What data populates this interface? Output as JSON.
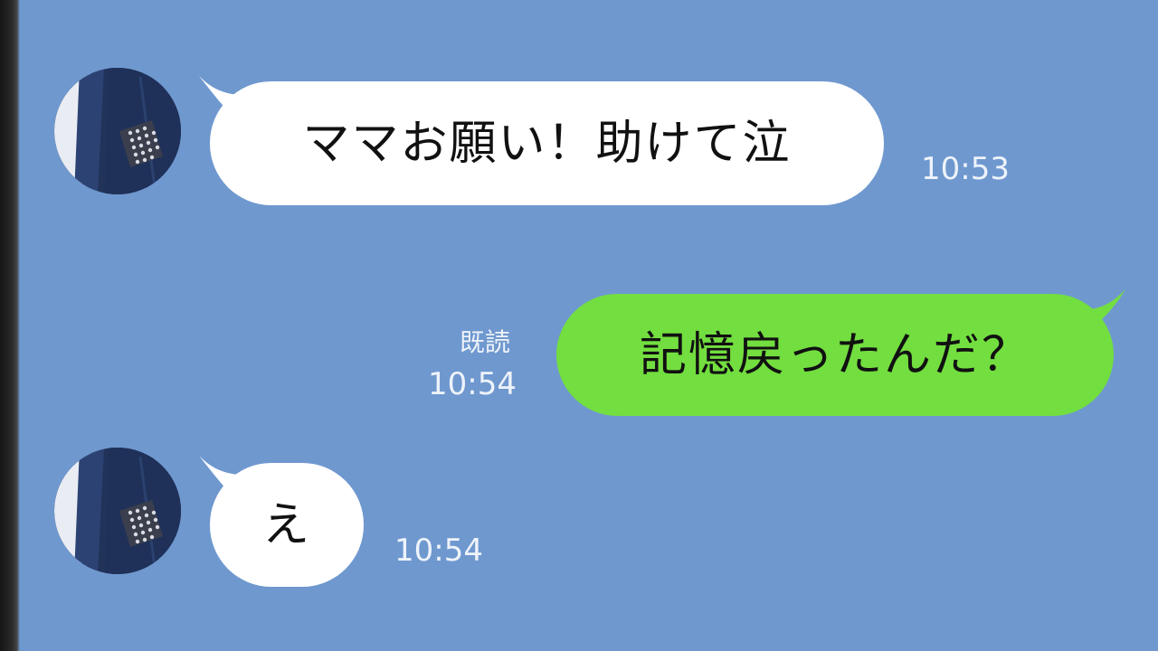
{
  "chat": {
    "background_color": "#6f98cf",
    "messages": [
      {
        "sender": "other",
        "text": "ママお願い！助けて泣",
        "time": "10:53",
        "bubble_color": "#ffffff",
        "avatar_icon": "contact-avatar-icon"
      },
      {
        "sender": "me",
        "text": "記憶戻ったんだ？",
        "time": "10:54",
        "read_label": "既読",
        "bubble_color": "#73de3f"
      },
      {
        "sender": "other",
        "text": "え",
        "time": "10:54",
        "bubble_color": "#ffffff",
        "avatar_icon": "contact-avatar-icon"
      }
    ]
  }
}
